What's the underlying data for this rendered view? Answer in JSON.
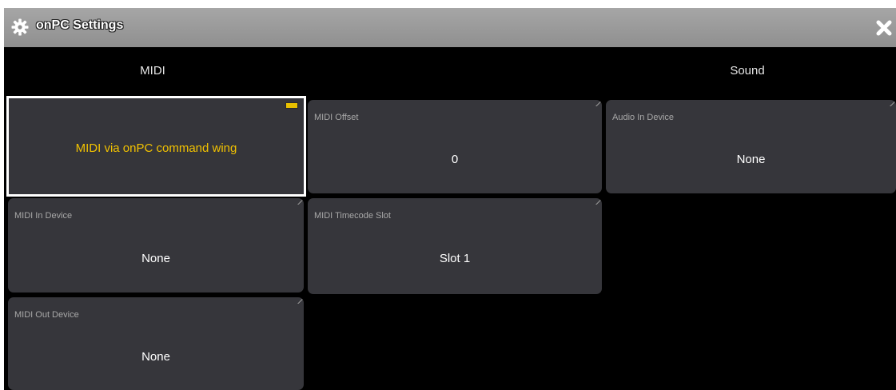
{
  "window": {
    "title": "onPC Settings",
    "title_icon": "gear-icon",
    "close_icon": "close-icon"
  },
  "tabs": [
    {
      "label": "MIDI"
    },
    {
      "label": "Sound"
    }
  ],
  "cells": {
    "midi_via_wing": {
      "value": "MIDI via onPC command wing",
      "selected": true
    },
    "midi_offset": {
      "label": "MIDI Offset",
      "value": "0"
    },
    "audio_in_device": {
      "label": "Audio In Device",
      "value": "None"
    },
    "midi_in_device": {
      "label": "MIDI In Device",
      "value": "None"
    },
    "midi_timecode_slot": {
      "label": "MIDI Timecode Slot",
      "value": "Slot 1"
    },
    "midi_out_device": {
      "label": "MIDI Out Device",
      "value": "None"
    }
  },
  "colors": {
    "titlebar": "#9a9a9a",
    "background": "#000000",
    "cell": "#36363b",
    "selected_text": "#f2c200",
    "selection_border": "#ffffff"
  }
}
